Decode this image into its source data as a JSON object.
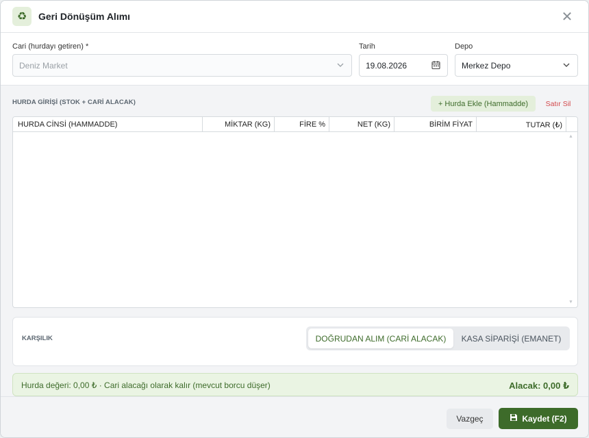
{
  "window": {
    "title": "Geri Dönüşüm Alımı",
    "icon": "recycle-icon",
    "close_glyph": "✕"
  },
  "form": {
    "cari": {
      "label": "Cari (hurdayı getiren) *",
      "value": "Deniz Market"
    },
    "tarih": {
      "label": "Tarih",
      "value": "19.08.2026"
    },
    "depo": {
      "label": "Depo",
      "value": "Merkez Depo"
    }
  },
  "hurda": {
    "section_title": "HURDA GİRİŞİ (STOK + CARİ ALACAK)",
    "add_label": "+ Hurda Ekle (Hammadde)",
    "delete_label": "Satır Sil",
    "columns": [
      "HURDA CİNSİ (HAMMADDE)",
      "MİKTAR (KG)",
      "FİRE %",
      "NET (KG)",
      "BİRİM FİYAT",
      "TUTAR (₺)"
    ],
    "rows": []
  },
  "karsilik": {
    "label": "KARŞILIK",
    "options": [
      "DOĞRUDAN ALIM (CARİ ALACAK)",
      "KASA SİPARİŞİ (EMANET)"
    ],
    "selected": "DOĞRUDAN ALIM (CARİ ALACAK)"
  },
  "summary": {
    "left": "Hurda değeri: 0,00 ₺  ·  Cari alacağı olarak kalır (mevcut borcu düşer)",
    "right": "Alacak: 0,00 ₺"
  },
  "footer": {
    "cancel_label": "Vazgeç",
    "save_label": "Kaydet (F2)"
  },
  "colors": {
    "accent": "#3d6b2a",
    "accent_light": "#e4efdb",
    "danger": "#d2484b"
  }
}
